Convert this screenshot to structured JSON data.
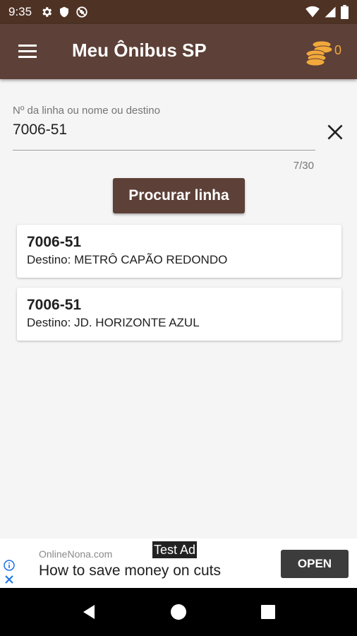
{
  "status_bar": {
    "time": "9:35",
    "icons_left": [
      "settings-icon",
      "shield-icon",
      "no-data-saver-icon"
    ],
    "icons_right": [
      "wifi-icon",
      "signal-icon",
      "battery-icon"
    ]
  },
  "app_bar": {
    "title": "Meu Ônibus SP",
    "coin_count": "0",
    "colors": {
      "bar": "#5d4037",
      "status": "#4e3224",
      "coins": "#f2a93b"
    }
  },
  "search": {
    "label": "Nº da linha ou nome ou destino",
    "value": "7006-51",
    "counter": "7/30",
    "button_label": "Procurar linha"
  },
  "results": [
    {
      "line": "7006-51",
      "destination": "Destino: METRÔ CAPÃO REDONDO"
    },
    {
      "line": "7006-51",
      "destination": "Destino: JD. HORIZONTE AZUL"
    }
  ],
  "ad": {
    "domain": "OnlineNona.com",
    "tag": "Test Ad",
    "headline": "How to save money on cuts",
    "button_label": "OPEN"
  },
  "nav_bar": {
    "icons": [
      "back-icon",
      "home-icon",
      "recents-icon"
    ]
  }
}
